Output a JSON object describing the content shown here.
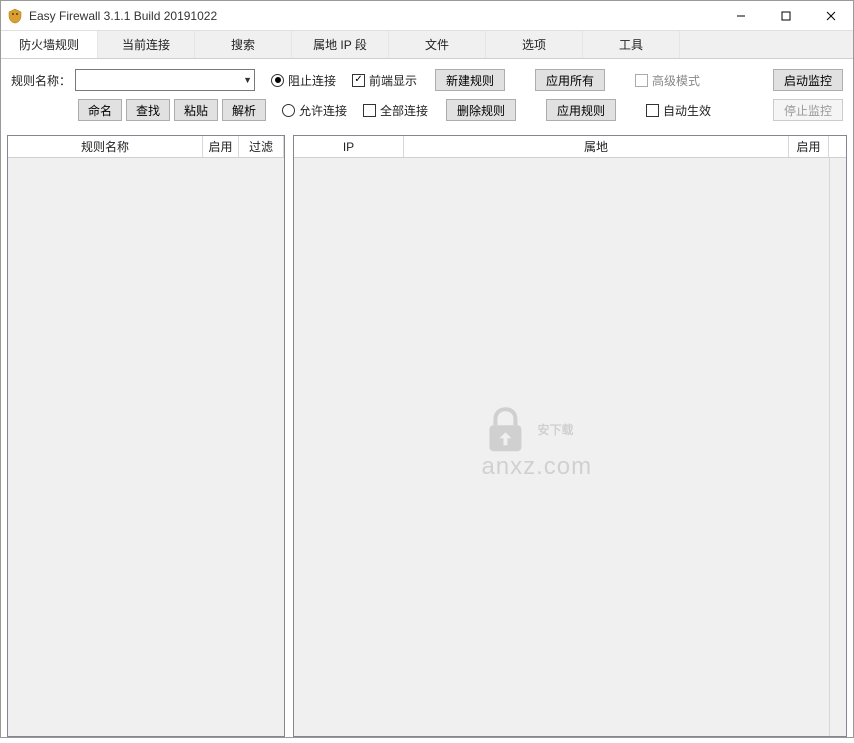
{
  "window": {
    "title": "Easy Firewall 3.1.1 Build 20191022"
  },
  "tabs": [
    {
      "label": "防火墙规则",
      "active": true
    },
    {
      "label": "当前连接",
      "active": false
    },
    {
      "label": "搜索",
      "active": false
    },
    {
      "label": "属地 IP 段",
      "active": false
    },
    {
      "label": "文件",
      "active": false
    },
    {
      "label": "选项",
      "active": false
    },
    {
      "label": "工具",
      "active": false
    }
  ],
  "toolbar": {
    "rule_name_label": "规则名称：",
    "rule_name_value": "",
    "btn_rename": "命名",
    "btn_find": "查找",
    "btn_paste": "粘贴",
    "btn_parse": "解析",
    "radio_block": "阻止连接",
    "radio_allow": "允许连接",
    "chk_foreground": "前端显示",
    "chk_all_conn": "全部连接",
    "btn_new_rule": "新建规则",
    "btn_delete_rule": "删除规则",
    "btn_apply_all": "应用所有",
    "btn_apply_rule": "应用规则",
    "chk_advanced": "高级模式",
    "chk_auto": "自动生效",
    "btn_start_monitor": "启动监控",
    "btn_stop_monitor": "停止监控"
  },
  "left_panel": {
    "cols": {
      "name": "规则名称",
      "enabled": "启用",
      "filter": "过滤"
    }
  },
  "right_panel": {
    "cols": {
      "ip": "IP",
      "location": "属地",
      "enabled": "启用"
    }
  },
  "watermark": {
    "text": "安下载",
    "url": "anxz.com"
  }
}
